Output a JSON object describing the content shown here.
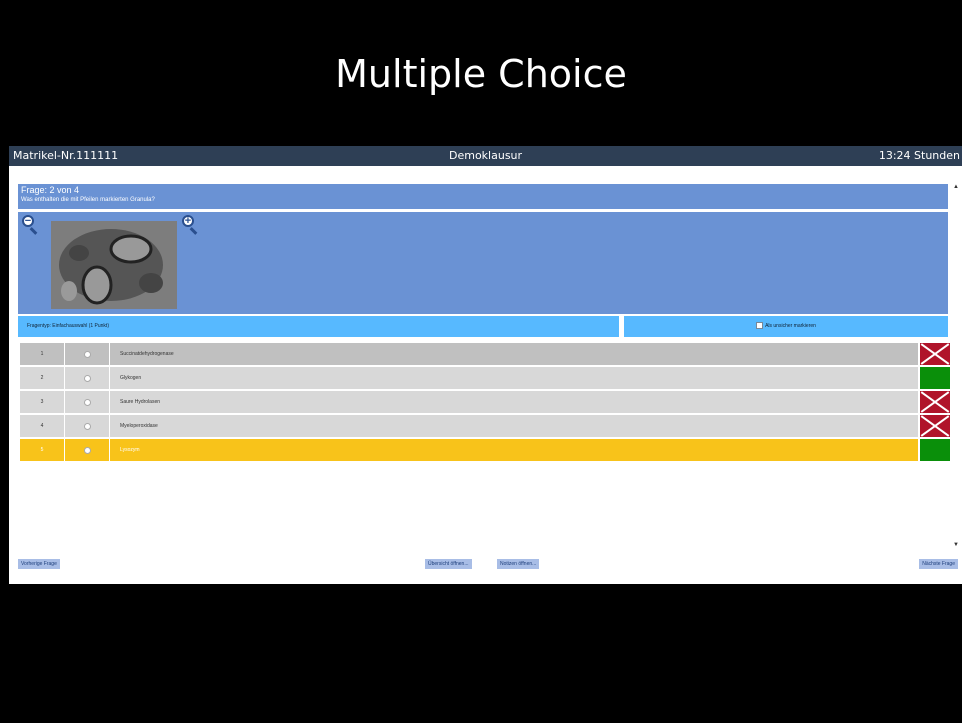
{
  "slide": {
    "title": "Multiple Choice"
  },
  "topbar": {
    "student": "Matrikel-Nr.111111",
    "exam": "Demoklausur",
    "time": "13:24 Stunden"
  },
  "question": {
    "number": "Frage: 2 von 4",
    "text": "Was enthalten die mit Pfeilen markierten Granula?"
  },
  "question_type": "Fragentyp: Einfachauswahl (1 Punkt)",
  "unsure_label": "Als unsicher markieren",
  "options": [
    {
      "n": "1",
      "label": "Succinatdehydrogenase"
    },
    {
      "n": "2",
      "label": "Glykogen"
    },
    {
      "n": "3",
      "label": "Saure Hydrolasen"
    },
    {
      "n": "4",
      "label": "Myeloperoxidase"
    },
    {
      "n": "5",
      "label": "Lysozym"
    }
  ],
  "nav": {
    "prev": "Vorherige Frage",
    "overview": "Übersicht öffnen...",
    "notes": "Notizen öffnen...",
    "next": "Nächste Frage"
  },
  "colors": {
    "header": "#2e3f55",
    "question_panel": "#6a92d4",
    "type_bar": "#57b9ff",
    "selected": "#f8c31a",
    "correct": "#0a8f0a",
    "wrong": "#b0142a"
  }
}
